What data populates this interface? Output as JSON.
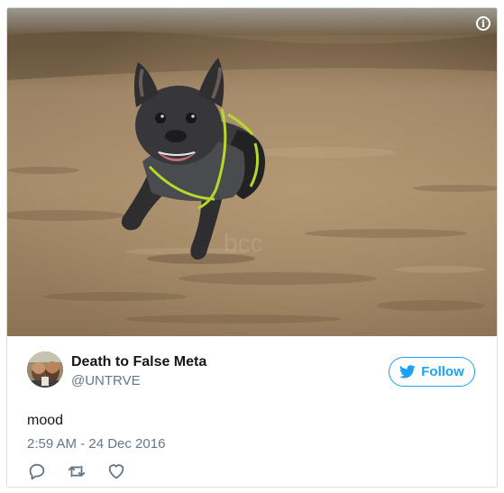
{
  "media": {
    "info_icon": "info-icon",
    "info_glyph": "i"
  },
  "author": {
    "name": "Death to False Meta",
    "handle": "@UNTRVE"
  },
  "follow": {
    "label": "Follow",
    "icon": "twitter-bird-icon"
  },
  "tweet": {
    "text": "mood",
    "timestamp": "2:59 AM - 24 Dec 2016"
  },
  "actions": [
    "reply-icon",
    "retweet-icon",
    "like-icon"
  ],
  "colors": {
    "accent": "#1da1f2",
    "text": "#14171a",
    "muted": "#657786",
    "border": "#d8dee3"
  }
}
